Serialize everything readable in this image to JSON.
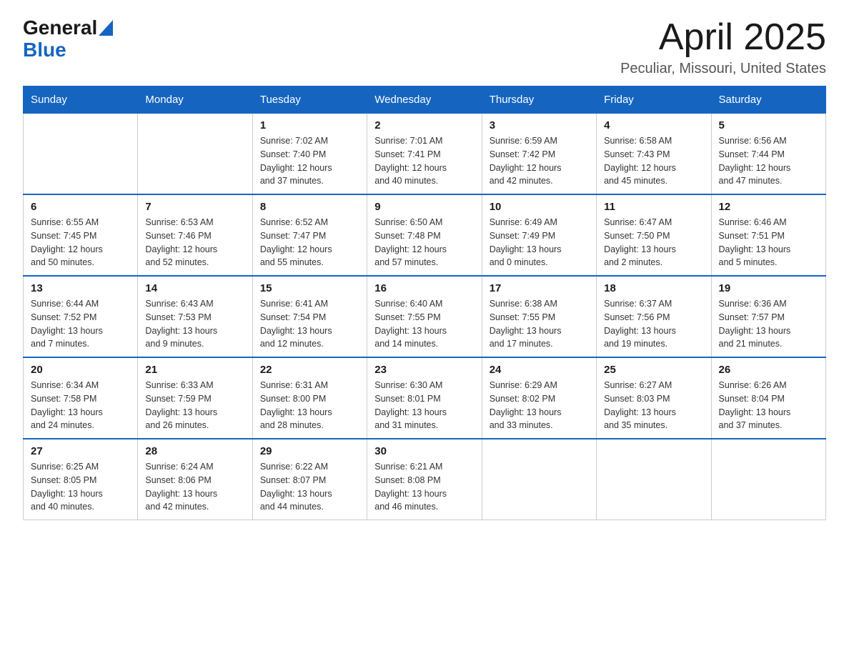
{
  "logo": {
    "general": "General",
    "blue": "Blue",
    "arrow": "▶"
  },
  "title": "April 2025",
  "subtitle": "Peculiar, Missouri, United States",
  "weekdays": [
    "Sunday",
    "Monday",
    "Tuesday",
    "Wednesday",
    "Thursday",
    "Friday",
    "Saturday"
  ],
  "weeks": [
    [
      {
        "day": "",
        "info": ""
      },
      {
        "day": "",
        "info": ""
      },
      {
        "day": "1",
        "info": "Sunrise: 7:02 AM\nSunset: 7:40 PM\nDaylight: 12 hours\nand 37 minutes."
      },
      {
        "day": "2",
        "info": "Sunrise: 7:01 AM\nSunset: 7:41 PM\nDaylight: 12 hours\nand 40 minutes."
      },
      {
        "day": "3",
        "info": "Sunrise: 6:59 AM\nSunset: 7:42 PM\nDaylight: 12 hours\nand 42 minutes."
      },
      {
        "day": "4",
        "info": "Sunrise: 6:58 AM\nSunset: 7:43 PM\nDaylight: 12 hours\nand 45 minutes."
      },
      {
        "day": "5",
        "info": "Sunrise: 6:56 AM\nSunset: 7:44 PM\nDaylight: 12 hours\nand 47 minutes."
      }
    ],
    [
      {
        "day": "6",
        "info": "Sunrise: 6:55 AM\nSunset: 7:45 PM\nDaylight: 12 hours\nand 50 minutes."
      },
      {
        "day": "7",
        "info": "Sunrise: 6:53 AM\nSunset: 7:46 PM\nDaylight: 12 hours\nand 52 minutes."
      },
      {
        "day": "8",
        "info": "Sunrise: 6:52 AM\nSunset: 7:47 PM\nDaylight: 12 hours\nand 55 minutes."
      },
      {
        "day": "9",
        "info": "Sunrise: 6:50 AM\nSunset: 7:48 PM\nDaylight: 12 hours\nand 57 minutes."
      },
      {
        "day": "10",
        "info": "Sunrise: 6:49 AM\nSunset: 7:49 PM\nDaylight: 13 hours\nand 0 minutes."
      },
      {
        "day": "11",
        "info": "Sunrise: 6:47 AM\nSunset: 7:50 PM\nDaylight: 13 hours\nand 2 minutes."
      },
      {
        "day": "12",
        "info": "Sunrise: 6:46 AM\nSunset: 7:51 PM\nDaylight: 13 hours\nand 5 minutes."
      }
    ],
    [
      {
        "day": "13",
        "info": "Sunrise: 6:44 AM\nSunset: 7:52 PM\nDaylight: 13 hours\nand 7 minutes."
      },
      {
        "day": "14",
        "info": "Sunrise: 6:43 AM\nSunset: 7:53 PM\nDaylight: 13 hours\nand 9 minutes."
      },
      {
        "day": "15",
        "info": "Sunrise: 6:41 AM\nSunset: 7:54 PM\nDaylight: 13 hours\nand 12 minutes."
      },
      {
        "day": "16",
        "info": "Sunrise: 6:40 AM\nSunset: 7:55 PM\nDaylight: 13 hours\nand 14 minutes."
      },
      {
        "day": "17",
        "info": "Sunrise: 6:38 AM\nSunset: 7:55 PM\nDaylight: 13 hours\nand 17 minutes."
      },
      {
        "day": "18",
        "info": "Sunrise: 6:37 AM\nSunset: 7:56 PM\nDaylight: 13 hours\nand 19 minutes."
      },
      {
        "day": "19",
        "info": "Sunrise: 6:36 AM\nSunset: 7:57 PM\nDaylight: 13 hours\nand 21 minutes."
      }
    ],
    [
      {
        "day": "20",
        "info": "Sunrise: 6:34 AM\nSunset: 7:58 PM\nDaylight: 13 hours\nand 24 minutes."
      },
      {
        "day": "21",
        "info": "Sunrise: 6:33 AM\nSunset: 7:59 PM\nDaylight: 13 hours\nand 26 minutes."
      },
      {
        "day": "22",
        "info": "Sunrise: 6:31 AM\nSunset: 8:00 PM\nDaylight: 13 hours\nand 28 minutes."
      },
      {
        "day": "23",
        "info": "Sunrise: 6:30 AM\nSunset: 8:01 PM\nDaylight: 13 hours\nand 31 minutes."
      },
      {
        "day": "24",
        "info": "Sunrise: 6:29 AM\nSunset: 8:02 PM\nDaylight: 13 hours\nand 33 minutes."
      },
      {
        "day": "25",
        "info": "Sunrise: 6:27 AM\nSunset: 8:03 PM\nDaylight: 13 hours\nand 35 minutes."
      },
      {
        "day": "26",
        "info": "Sunrise: 6:26 AM\nSunset: 8:04 PM\nDaylight: 13 hours\nand 37 minutes."
      }
    ],
    [
      {
        "day": "27",
        "info": "Sunrise: 6:25 AM\nSunset: 8:05 PM\nDaylight: 13 hours\nand 40 minutes."
      },
      {
        "day": "28",
        "info": "Sunrise: 6:24 AM\nSunset: 8:06 PM\nDaylight: 13 hours\nand 42 minutes."
      },
      {
        "day": "29",
        "info": "Sunrise: 6:22 AM\nSunset: 8:07 PM\nDaylight: 13 hours\nand 44 minutes."
      },
      {
        "day": "30",
        "info": "Sunrise: 6:21 AM\nSunset: 8:08 PM\nDaylight: 13 hours\nand 46 minutes."
      },
      {
        "day": "",
        "info": ""
      },
      {
        "day": "",
        "info": ""
      },
      {
        "day": "",
        "info": ""
      }
    ]
  ]
}
